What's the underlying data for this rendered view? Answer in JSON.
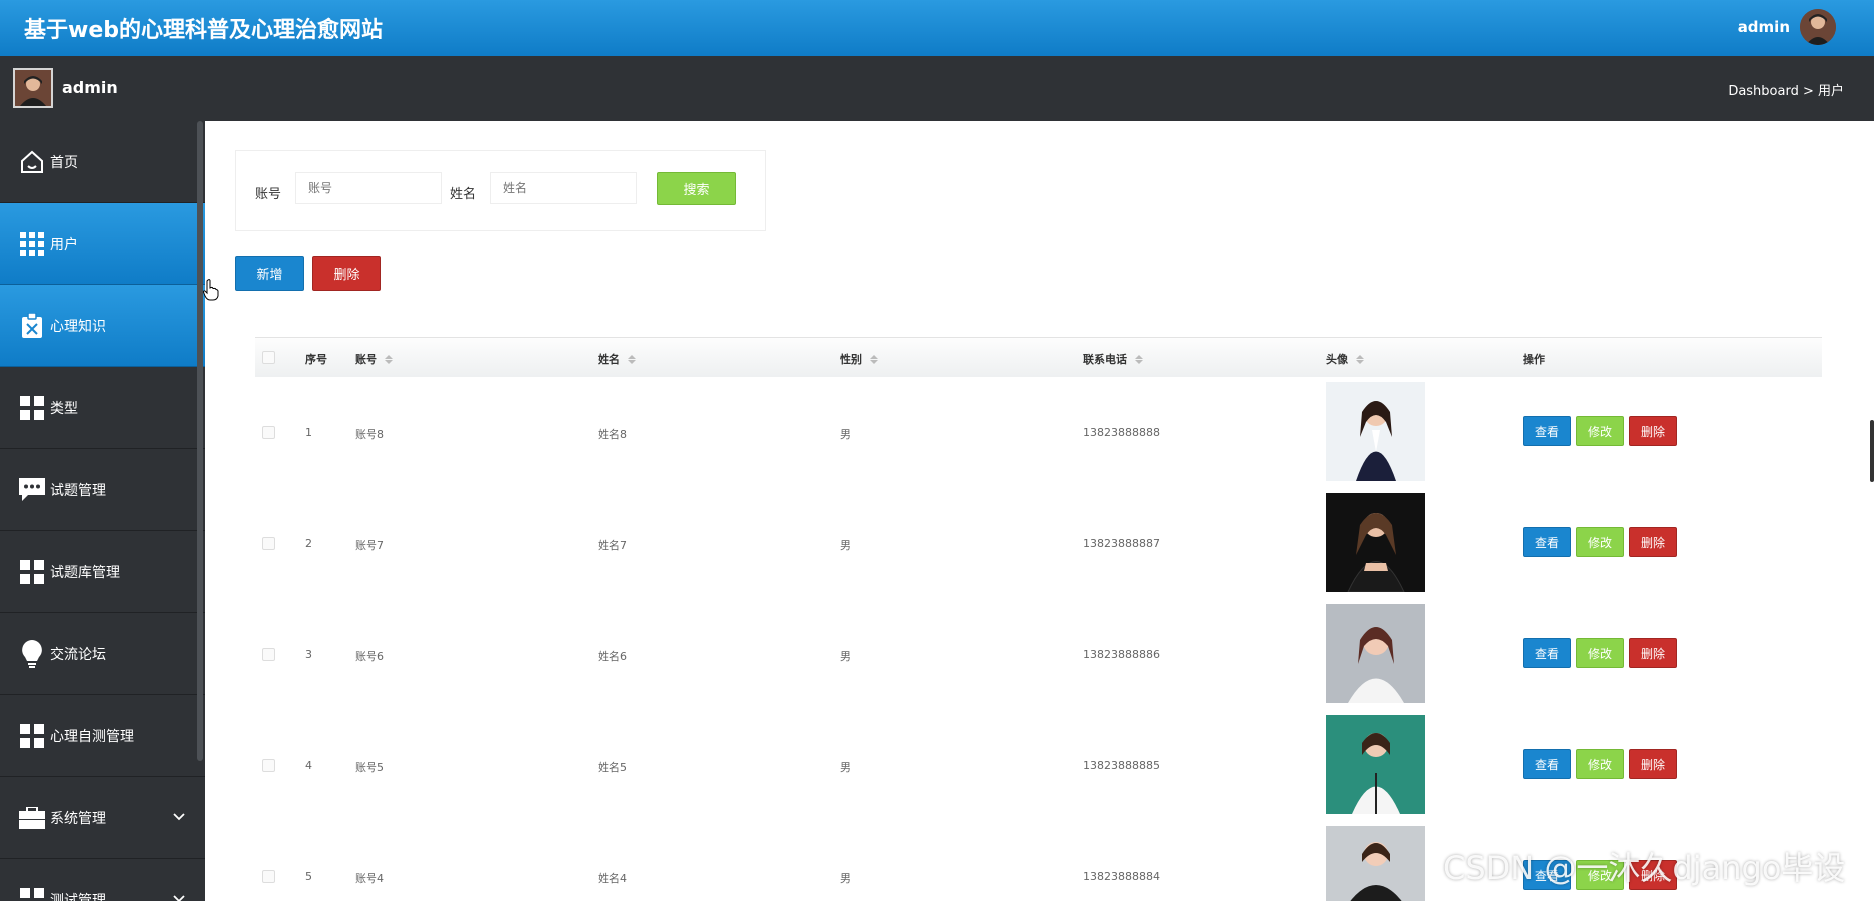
{
  "header": {
    "title": "基于web的心理科普及心理治愈网站",
    "user": "admin"
  },
  "subbar": {
    "user": "admin",
    "breadcrumb": "Dashboard > 用户"
  },
  "sidebar": {
    "items": [
      {
        "label": "首页",
        "icon": "home-icon"
      },
      {
        "label": "用户",
        "icon": "grid-icon"
      },
      {
        "label": "心理知识",
        "icon": "clipboard-icon"
      },
      {
        "label": "类型",
        "icon": "tiles-icon"
      },
      {
        "label": "试题管理",
        "icon": "chat-icon"
      },
      {
        "label": "试题库管理",
        "icon": "tiles-icon"
      },
      {
        "label": "交流论坛",
        "icon": "bulb-icon"
      },
      {
        "label": "心理自测管理",
        "icon": "tiles-icon"
      },
      {
        "label": "系统管理",
        "icon": "briefcase-icon"
      },
      {
        "label": "测试管理",
        "icon": "tiles-icon"
      }
    ]
  },
  "search": {
    "account_label": "账号",
    "account_placeholder": "账号",
    "name_label": "姓名",
    "name_placeholder": "姓名",
    "button": "搜索"
  },
  "toolbar": {
    "add": "新增",
    "delete": "删除"
  },
  "table": {
    "headers": {
      "index": "序号",
      "account": "账号",
      "name": "姓名",
      "gender": "性别",
      "phone": "联系电话",
      "avatar": "头像",
      "actions": "操作"
    },
    "rows": [
      {
        "index": "1",
        "account": "账号8",
        "name": "姓名8",
        "gender": "男",
        "phone": "13823888888"
      },
      {
        "index": "2",
        "account": "账号7",
        "name": "姓名7",
        "gender": "男",
        "phone": "13823888887"
      },
      {
        "index": "3",
        "account": "账号6",
        "name": "姓名6",
        "gender": "男",
        "phone": "13823888886"
      },
      {
        "index": "4",
        "account": "账号5",
        "name": "姓名5",
        "gender": "男",
        "phone": "13823888885"
      },
      {
        "index": "5",
        "account": "账号4",
        "name": "姓名4",
        "gender": "男",
        "phone": "13823888884"
      }
    ],
    "actions": {
      "view": "查看",
      "edit": "修改",
      "delete": "删除"
    }
  },
  "watermark": "CSDN @一沐久django毕设",
  "colors": {
    "primary": "#1a86cf",
    "success": "#8cd44a",
    "danger": "#c9302c",
    "dark": "#2f3236"
  }
}
